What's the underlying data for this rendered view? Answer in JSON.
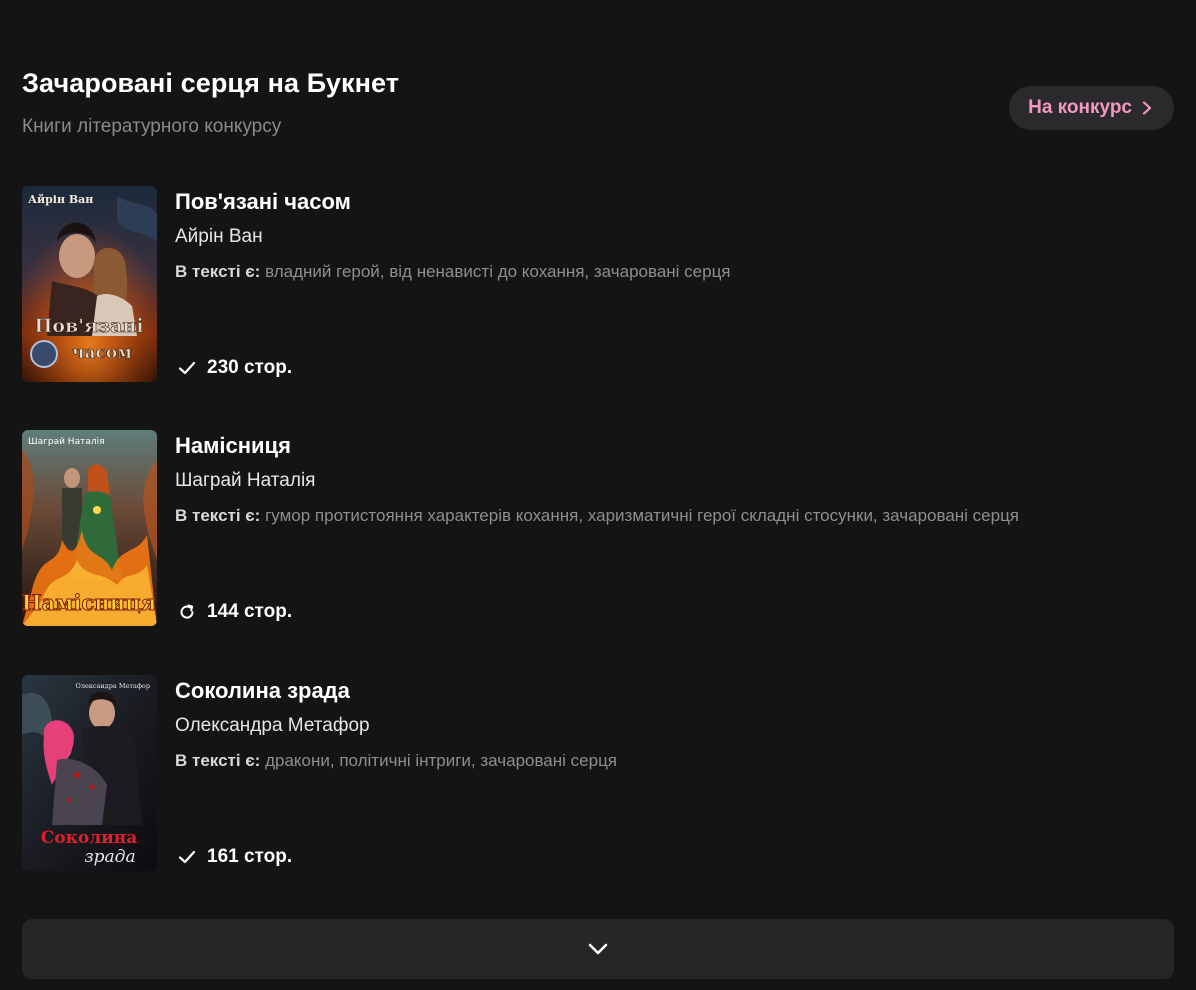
{
  "section": {
    "title": "Зачаровані серця на Букнет",
    "subtitle": "Книги літературного конкурсу",
    "contest_button": {
      "label": "На конкурс",
      "icon": "chevron-right-icon",
      "color": "#f397c2"
    }
  },
  "tags_label": "В тексті є:",
  "books": [
    {
      "title": "Пов'язані часом",
      "author": "Айрін Ван",
      "tags": "владний герой, від ненависті до кохання, зачаровані серця",
      "pages": "230 стор.",
      "status_icon": "check-icon",
      "cover": {
        "top_text": "Айрін Ван",
        "title_line1": "Пов'язані",
        "title_line2": "часом"
      }
    },
    {
      "title": "Намісниця",
      "author": "Шаграй Наталія",
      "tags": "гумор протистояння характерів кохання, харизматичні герої складні стосунки, зачаровані серця",
      "pages": "144 стор.",
      "status_icon": "refresh-icon",
      "cover": {
        "top_text": "Шаграй Наталія",
        "title_line1": "Намісниця"
      }
    },
    {
      "title": "Соколина зрада",
      "author": "Олександра Метафор",
      "tags": "дракони, політичні інтриги, зачаровані серця",
      "pages": "161 стор.",
      "status_icon": "check-icon",
      "cover": {
        "top_text": "Олександра Метафор",
        "title_line1": "Соколина",
        "title_line2": "зрада"
      }
    }
  ],
  "show_more": {
    "icon": "chevron-down-icon"
  }
}
